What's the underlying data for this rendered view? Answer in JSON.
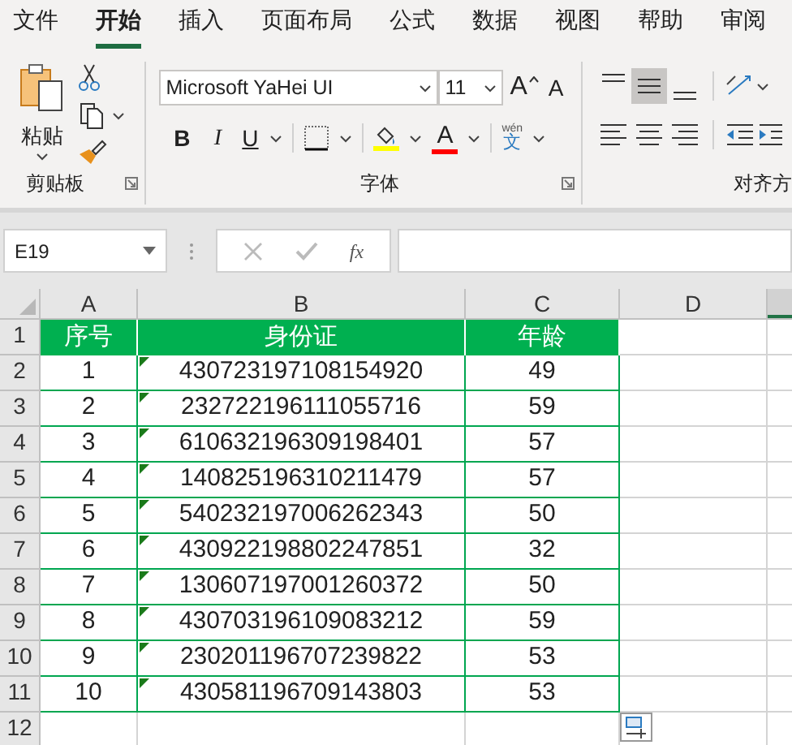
{
  "tabs": [
    {
      "label": "文件",
      "selected": false
    },
    {
      "label": "开始",
      "selected": true
    },
    {
      "label": "插入",
      "selected": false
    },
    {
      "label": "页面布局",
      "selected": false
    },
    {
      "label": "公式",
      "selected": false
    },
    {
      "label": "数据",
      "selected": false
    },
    {
      "label": "视图",
      "selected": false
    },
    {
      "label": "帮助",
      "selected": false
    },
    {
      "label": "审阅",
      "selected": false
    }
  ],
  "ribbon": {
    "clipboard": {
      "paste": "粘贴",
      "label": "剪贴板"
    },
    "font": {
      "font_name": "Microsoft YaHei UI",
      "font_size": "11",
      "grow": "A",
      "shrink": "A",
      "bold": "B",
      "italic": "I",
      "underline": "U",
      "font_color": "A",
      "phonetic_top": "wén",
      "phonetic_bottom": "文",
      "label": "字体"
    },
    "alignment": {
      "label": "对齐方",
      "vertical": [
        {
          "kind": "top",
          "selected": false
        },
        {
          "kind": "middle",
          "selected": true
        },
        {
          "kind": "bottom",
          "selected": false
        }
      ],
      "horizontal": [
        {
          "kind": "left"
        },
        {
          "kind": "center"
        },
        {
          "kind": "right"
        }
      ]
    }
  },
  "formula_bar": {
    "name_box": "E19",
    "fx": "fx"
  },
  "columns": [
    {
      "label": "A",
      "selected": false
    },
    {
      "label": "B",
      "selected": false
    },
    {
      "label": "C",
      "selected": false
    },
    {
      "label": "D",
      "selected": false
    }
  ],
  "partial_column": {
    "selected": true
  },
  "header_row": {
    "number": "1",
    "cells": [
      "序号",
      "身份证",
      "年龄"
    ]
  },
  "rows": [
    {
      "number": "2",
      "cells": [
        "1",
        "430723197108154920",
        "49"
      ],
      "flagged": true
    },
    {
      "number": "3",
      "cells": [
        "2",
        "232722196111055716",
        "59"
      ],
      "flagged": true
    },
    {
      "number": "4",
      "cells": [
        "3",
        "610632196309198401",
        "57"
      ],
      "flagged": true
    },
    {
      "number": "5",
      "cells": [
        "4",
        "140825196310211479",
        "57"
      ],
      "flagged": true
    },
    {
      "number": "6",
      "cells": [
        "5",
        "540232197006262343",
        "50"
      ],
      "flagged": true
    },
    {
      "number": "7",
      "cells": [
        "6",
        "430922198802247851",
        "32"
      ],
      "flagged": true
    },
    {
      "number": "8",
      "cells": [
        "7",
        "130607197001260372",
        "50"
      ],
      "flagged": true
    },
    {
      "number": "9",
      "cells": [
        "8",
        "430703196109083212",
        "59"
      ],
      "flagged": true
    },
    {
      "number": "10",
      "cells": [
        "9",
        "230201196707239822",
        "53"
      ],
      "flagged": true
    },
    {
      "number": "11",
      "cells": [
        "10",
        "430581196709143803",
        "53"
      ],
      "flagged": true
    }
  ],
  "empty_row": {
    "number": "12"
  }
}
